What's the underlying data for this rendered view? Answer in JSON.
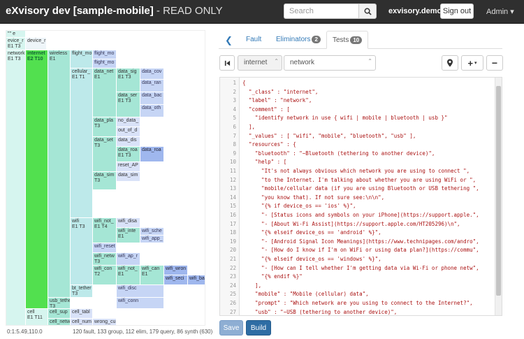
{
  "navbar": {
    "brand_main": "eXvisory dev [sample-mobile]",
    "brand_suffix": " - READ ONLY",
    "search_placeholder": "Search",
    "domain": "exvisory.demo",
    "signout_label": "Sign out",
    "admin_label": "Admin ▾"
  },
  "tree": {
    "cells": {
      "top": "\"'' e",
      "device_r": "evice_r",
      "e1t3": "E1 T3",
      "device_r2": "device_r",
      "network": "network",
      "network_sub": "E1 T3",
      "internet": "internet",
      "internet_sub": "E2 T10",
      "wireless": "wireless",
      "wireless_sub": "E1",
      "flight_mo": "flight_mo",
      "flight_mo2": "flight_mo",
      "flight_mo3": "flight_mo",
      "cellular": "cellular_",
      "cellular_sub": "E1 T1",
      "data_net": "data_net",
      "data_net_sub": "E1",
      "data_sig": "data_sig",
      "data_sig_sub": "E1 T3",
      "data_cov": "data_cov",
      "data_ran": "data_ran",
      "data_ser": "data_ser",
      "data_ser_sub": "E1 T3",
      "data_bac": "data_bac",
      "data_oth": "data_oth",
      "data_pla": "data_pla",
      "data_pla_sub": "T3",
      "no_data": "no_data_",
      "out_of_d": "out_of_d",
      "data_set": "data_set",
      "data_set_sub": "T3",
      "data_dis": "data_dis",
      "data_roa": "data_roa",
      "data_roa_sub": "E1 T3",
      "data_roa2": "data_roa",
      "reset_ap": "reset_AP",
      "data_sim": "data_sim",
      "data_sim_sub": "T3",
      "data_sim2": "data_sim",
      "wifi": "wifi",
      "wifi_sub": "E1 T3",
      "wifi_not": "wifi_not_",
      "wifi_not_sub": "E1 T4",
      "wifi_disa": "wifi_disa",
      "wifi_inte": "wifi_inte",
      "wifi_inte_sub": "E1",
      "wifi_sche": "wifi_sche",
      "wifi_app": "wifi_app_",
      "wifi_reset": "wifi_reset",
      "wifi_netw": "wifi_netw",
      "wifi_netw_sub": "T3",
      "wifi_ap_r": "wifi_ap_r",
      "wifi_con": "wifi_con",
      "wifi_con_sub": "T2",
      "wifi_not2": "wifi_not_",
      "wifi_not2_sub": "E1",
      "wifi_can": "wifi_can",
      "wifi_can_sub": "E1",
      "wifi_wron": "wifi_wron",
      "wifi_seci": "wifi_seci",
      "wifi_bad": "wifi_bad_",
      "wifi_disc": "wifi_disc",
      "wifi_conn": "wifi_conn",
      "bt_tether": "bt_tether",
      "bt_tether_sub": "T3",
      "usb_tether": "usb_tethe",
      "usb_tether_sub": "T3",
      "cell": "cell",
      "cell_sub": "E1 T11",
      "cell_sup": "cell_sup",
      "cell_tabl": "cell_tabl",
      "cell_netw": "cell_netw",
      "cell_num": "cell_num",
      "wrong_cu": "wrong_cu"
    },
    "footer_left": "0:1:5.49,110.0",
    "footer_right": "120 fault, 133 group, 112 elim, 179 query, 86 synth (630)"
  },
  "tabs": {
    "back_icon": "chevron-left",
    "items": [
      {
        "label": "Fault",
        "badge": ""
      },
      {
        "label": "Eliminators",
        "badge": "2"
      },
      {
        "label": "Tests",
        "badge": "10"
      }
    ]
  },
  "toolbar": {
    "class_select": "internet",
    "label_select": "network"
  },
  "editor": {
    "line_numbers": [
      "1",
      "2",
      "3",
      "4",
      "5",
      "6",
      "7",
      "8",
      "9",
      "10",
      "11",
      "12",
      "13",
      "14",
      "15",
      "16",
      "17",
      "18",
      "19",
      "20",
      "21",
      "22",
      "23",
      "24",
      "25",
      "26",
      "27"
    ],
    "lines": [
      "{",
      "  \"_class\" : \"internet\",",
      "  \"label\" : \"network\",",
      "  \"comment\" : [",
      "    \"identify network in use { wifi | mobile | bluetooth | usb }\"",
      "  ],",
      "  \"_values\" : [ \"wifi\", \"mobile\", \"bluetooth\", \"usb\" ],",
      "  \"resources\" : {",
      "    \"bluetooth\" : \"~Bluetooth (tethering to another device)\",",
      "    \"help\" : [",
      "      \"It's not always obvious which network you are using to connect \",",
      "      \"to the Internet. I'm talking about whether you are using WiFi or \",",
      "      \"mobile/cellular data (if you are using Bluetooth or USB tethering \",",
      "      \"you know that). If not sure see:\\n\\n\",",
      "      \"{% if device_os == 'ios' %}\",",
      "      \"- [Status icons and symbols on your iPhone](https://support.apple.\",",
      "      \"- [About Wi-Fi Assist](https://support.apple.com/HT205296)\\n\",",
      "      \"{% elseif device_os == 'android' %}\",",
      "      \"- [Android Signal Icon Meanings](https://www.technipages.com/andro\",",
      "      \"- [How do I know if I'm on WiFi or using data plan?](https://commu\",",
      "      \"{% elseif device_os == 'windows' %}\",",
      "      \"- [How can I tell whether I'm getting data via Wi-Fi or phone netw\",",
      "      \"{% endif %}\"",
      "    ],",
      "    \"mobile\" : \"Mobile (cellular) data\",",
      "    \"prompt\" : \"Which network are you using to connect to the Internet?\",",
      "    \"usb\" : \"~USB (tethering to another device)\","
    ]
  },
  "footer": {
    "save_label": "Save",
    "build_label": "Build"
  }
}
